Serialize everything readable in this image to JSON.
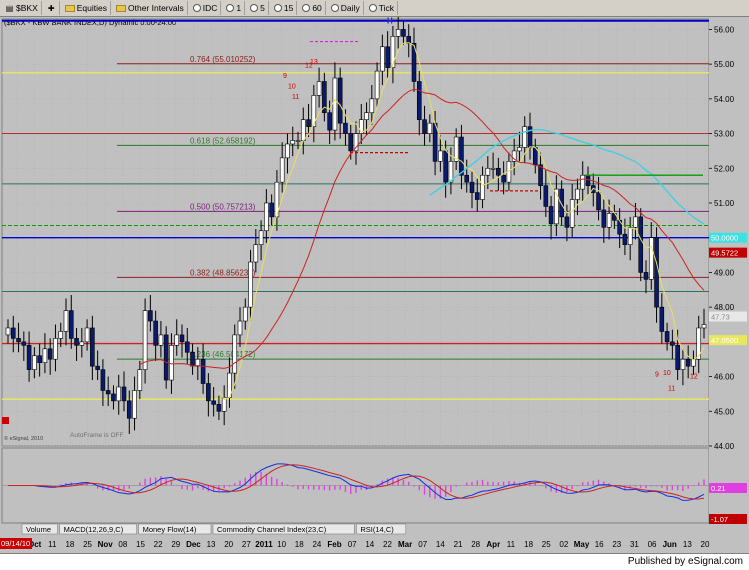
{
  "toolbar": {
    "symbol": "$BKX",
    "equities_label": "Equities",
    "other_intervals_label": "Other Intervals",
    "idc_label": "IDC",
    "one_label": "1",
    "five_label": "5",
    "fifteen_label": "15",
    "sixty_label": "60",
    "daily_label": "Daily",
    "tick_label": "Tick"
  },
  "chart_title": "($BKX - KBW BANK INDEX,D) Dynamic 0:00-24:00",
  "autoframe_label": "AutoFrame is OFF",
  "esignal_label": "© eSignal, 2010",
  "published_label": "Published by eSignal.com",
  "date_stamp": "09/14/10",
  "price_axis": [
    "56.00",
    "55.00",
    "54.00",
    "53.00",
    "52.00",
    "51.00",
    "50.00",
    "49.00",
    "48.00",
    "47.00",
    "46.00",
    "45.00",
    "44.00"
  ],
  "price_tags": {
    "cyan": "50.0000",
    "red": "49.5722",
    "gray": "47.73",
    "yellow": "47.0500"
  },
  "macd_tags": {
    "magenta": "0.21",
    "red": "-1.07"
  },
  "fib_labels": [
    "0.764 (55.010252)",
    "0.618 (52.658192)",
    "0.500 (50.757213)",
    "0.382 (48.856232)",
    "0.236 (46.504172)"
  ],
  "date_ticks": [
    "27",
    "Oct",
    "11",
    "18",
    "25",
    "Nov",
    "08",
    "15",
    "22",
    "29",
    "Dec",
    "13",
    "20",
    "27",
    "2011",
    "10",
    "18",
    "24",
    "Feb",
    "07",
    "14",
    "22",
    "Mar",
    "07",
    "14",
    "21",
    "28",
    "Apr",
    "11",
    "18",
    "25",
    "02",
    "May",
    "16",
    "23",
    "31",
    "06",
    "Jun",
    "13",
    "20"
  ],
  "date_ticks_bold": [
    "Oct",
    "Nov",
    "Dec",
    "2011",
    "Feb",
    "Mar",
    "Apr",
    "May",
    "Jun"
  ],
  "tabs": [
    "Volume",
    "MACD(12,26,9,C)",
    "Money Flow(14)",
    "Commodity Channel Index(23,C)",
    "RSI(14,C)"
  ],
  "count_labels": {
    "top_h": "H",
    "red_13": "13",
    "red_12": "12",
    "red_11": "11",
    "red_10": "10",
    "red_9": "9"
  },
  "chart_data": {
    "type": "candlestick",
    "title": "($BKX - KBW BANK INDEX,D) Dynamic 0:00-24:00",
    "ylim": [
      44,
      56.3
    ],
    "fib_levels": [
      {
        "ratio": 0.764,
        "value": 55.010252
      },
      {
        "ratio": 0.618,
        "value": 52.658192
      },
      {
        "ratio": 0.5,
        "value": 50.757213
      },
      {
        "ratio": 0.382,
        "value": 48.856232
      },
      {
        "ratio": 0.236,
        "value": 46.504172
      }
    ],
    "closes": [
      47.4,
      47.1,
      47.0,
      46.9,
      46.2,
      46.6,
      46.4,
      46.8,
      46.5,
      47.1,
      47.3,
      47.9,
      47.1,
      46.9,
      47.0,
      47.4,
      46.3,
      46.2,
      45.6,
      45.5,
      45.3,
      45.7,
      45.3,
      44.8,
      45.6,
      46.2,
      47.9,
      47.6,
      46.9,
      47.2,
      45.9,
      46.9,
      47.2,
      47.0,
      46.7,
      46.3,
      46.5,
      45.8,
      45.3,
      45.2,
      45.0,
      45.4,
      46.1,
      47.2,
      47.6,
      48.0,
      49.3,
      49.8,
      50.2,
      51.0,
      50.6,
      51.6,
      52.3,
      52.7,
      52.8,
      52.8,
      53.4,
      53.2,
      54.1,
      54.5,
      53.6,
      53.1,
      54.6,
      53.3,
      53.0,
      52.5,
      53.0,
      53.4,
      53.6,
      54.0,
      54.8,
      55.5,
      54.9,
      55.8,
      56.0,
      55.8,
      55.6,
      54.5,
      53.4,
      53.0,
      53.3,
      52.2,
      52.5,
      51.6,
      52.2,
      52.9,
      51.8,
      51.6,
      51.3,
      51.1,
      51.8,
      52.0,
      52.0,
      51.8,
      51.6,
      52.2,
      52.5,
      52.6,
      53.2,
      52.6,
      52.1,
      51.5,
      50.9,
      50.4,
      51.4,
      50.6,
      50.3,
      51.1,
      51.4,
      51.8,
      51.5,
      51.3,
      50.8,
      50.3,
      50.7,
      50.5,
      50.1,
      49.8,
      50.3,
      50.6,
      49.0,
      48.8,
      50.0,
      48.0,
      47.3,
      47.0,
      46.9,
      46.2,
      46.5,
      46.3,
      46.5,
      47.4,
      47.5
    ]
  }
}
